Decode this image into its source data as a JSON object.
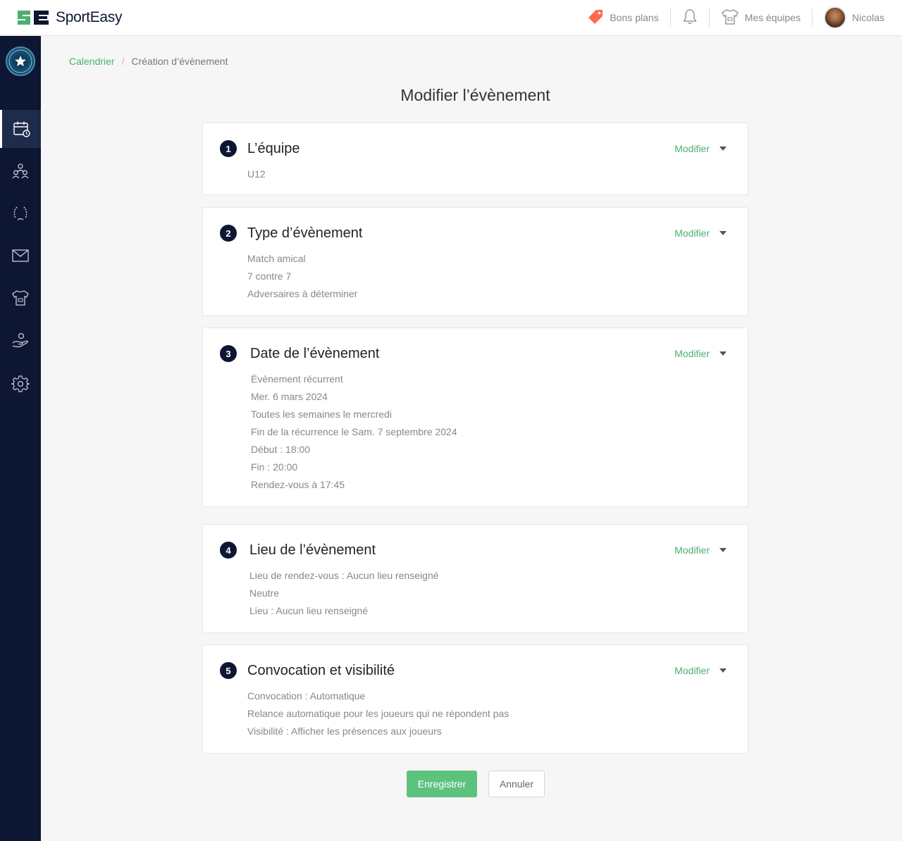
{
  "header": {
    "logo_text": "SportEasy",
    "nav": {
      "deals": "Bons plans",
      "teams": "Mes équipes",
      "user": "Nicolas"
    }
  },
  "breadcrumb": {
    "link": "Calendrier",
    "separator": "/",
    "current": "Création d’évènement"
  },
  "page_title": "Modifier l’évènement",
  "modify_label": "Modifier",
  "sections": [
    {
      "num": "1",
      "title": "L’équipe",
      "lines": [
        "U12"
      ]
    },
    {
      "num": "2",
      "title": "Type d’évènement",
      "lines": [
        "Match amical",
        "7 contre 7",
        "Adversaires à déterminer"
      ]
    },
    {
      "num": "3",
      "title": "Date de l’évènement",
      "lines": [
        "Évènement récurrent",
        "Mer. 6 mars 2024",
        "Toutes les semaines le mercredi",
        "Fin de la récurrence le Sam. 7 septembre 2024",
        "Début : 18:00",
        "Fin : 20:00",
        "Rendez-vous à 17:45"
      ]
    },
    {
      "num": "4",
      "title": "Lieu de l’évènement",
      "lines": [
        "Lieu de rendez-vous : Aucun lieu renseigné",
        "Neutre",
        "Lieu : Aucun lieu renseigné"
      ]
    },
    {
      "num": "5",
      "title": "Convocation et visibilité",
      "lines": [
        "Convocation : Automatique",
        "Relance automatique pour les joueurs qui ne répondent pas",
        "Visibilité : Afficher les présences aux joueurs"
      ]
    }
  ],
  "buttons": {
    "save": "Enregistrer",
    "cancel": "Annuler"
  },
  "colors": {
    "sidebar": "#0d1633",
    "accent_green": "#4caf6e",
    "save_button": "#5ec27f",
    "deals_tag": "#ff6b4a"
  },
  "icons": {
    "sidebar": [
      "calendar-icon",
      "members-icon",
      "trophy-icon",
      "mail-icon",
      "jersey-icon",
      "hand-heart-icon",
      "settings-icon"
    ],
    "header": [
      "tag-icon",
      "bell-icon",
      "jersey-icon"
    ]
  }
}
